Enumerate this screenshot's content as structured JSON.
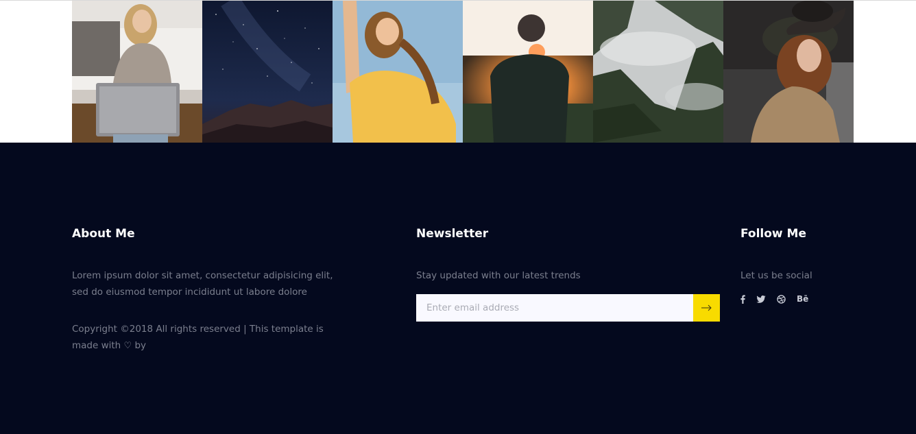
{
  "gallery": {
    "images": [
      {
        "name": "woman-laptop-photo"
      },
      {
        "name": "starry-sky-photo"
      },
      {
        "name": "woman-sun-photo"
      },
      {
        "name": "man-sunset-photo"
      },
      {
        "name": "misty-mountains-photo"
      },
      {
        "name": "woman-hat-photo"
      }
    ]
  },
  "footer": {
    "about": {
      "title": "About Me",
      "description": "Lorem ipsum dolor sit amet, consectetur adipisicing elit, sed do eiusmod tempor incididunt ut labore dolore",
      "copyright_prefix": "Copyright ©2018 All rights reserved | This template is made with",
      "copyright_suffix": "by"
    },
    "newsletter": {
      "title": "Newsletter",
      "description": "Stay updated with our latest trends",
      "email_placeholder": "Enter email address",
      "button_color": "#f8db00"
    },
    "follow": {
      "title": "Follow Me",
      "description": "Let us be social",
      "social_icons": [
        "facebook-icon",
        "twitter-icon",
        "dribbble-icon",
        "behance-icon"
      ],
      "behance_label": "Bē"
    },
    "background_color": "#04091e"
  }
}
